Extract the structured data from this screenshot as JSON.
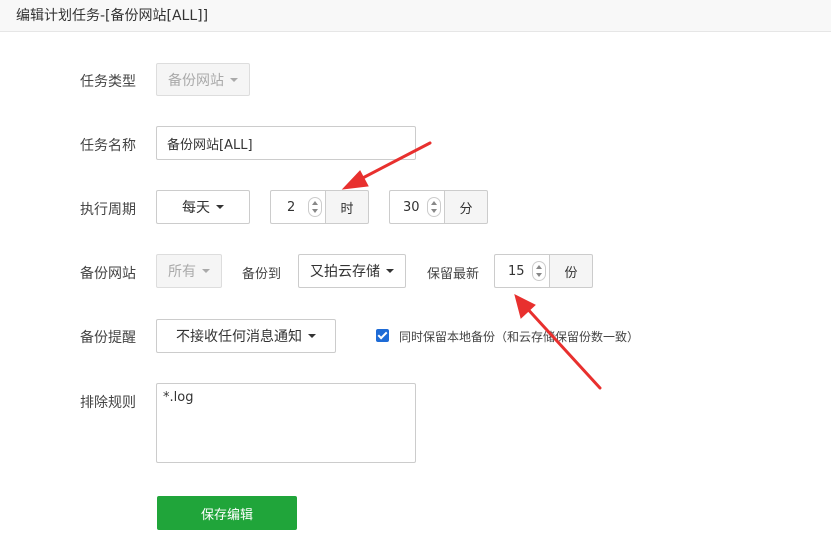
{
  "window": {
    "title": "编辑计划任务-[备份网站[ALL]]"
  },
  "form": {
    "task_type": {
      "label": "任务类型",
      "value": "备份网站"
    },
    "task_name": {
      "label": "任务名称",
      "value": "备份网站[ALL]"
    },
    "cycle": {
      "label": "执行周期",
      "period": "每天",
      "hour_value": "2",
      "hour_unit": "时",
      "minute_value": "30",
      "minute_unit": "分"
    },
    "backup_site": {
      "label": "备份网站",
      "site_value": "所有",
      "backup_to_label": "备份到",
      "backup_to_value": "又拍云存储",
      "keep_label": "保留最新",
      "keep_value": "15",
      "keep_unit": "份"
    },
    "notify": {
      "label": "备份提醒",
      "value": "不接收任何消息通知",
      "keep_local_checked": true,
      "keep_local_label": "同时保留本地备份（和云存储保留份数一致）"
    },
    "exclude": {
      "label": "排除规则",
      "value": "*.log"
    },
    "save_label": "保存编辑"
  },
  "colors": {
    "primary_green": "#20a53a",
    "annotation_red": "#e8302e",
    "checkbox_blue": "#1e6bd6"
  }
}
